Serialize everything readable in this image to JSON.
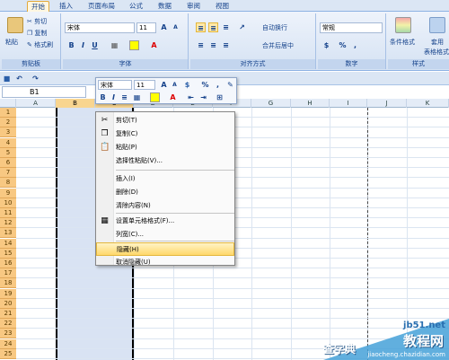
{
  "tabs": [
    "开始",
    "插入",
    "页面布局",
    "公式",
    "数据",
    "审阅",
    "视图"
  ],
  "clipboard": {
    "paste": "粘贴",
    "cut": "剪切",
    "copy": "复制",
    "format_painter": "格式刷",
    "label": "剪贴板"
  },
  "font": {
    "name": "宋体",
    "size": "11",
    "label": "字体",
    "bold": "B",
    "italic": "I",
    "underline": "U",
    "grow": "A",
    "shrink": "A"
  },
  "alignment": {
    "wrap": "自动换行",
    "merge": "合并后居中",
    "label": "对齐方式"
  },
  "number": {
    "format": "常规",
    "percent": "%",
    "comma": ",",
    "label": "数字"
  },
  "styles": {
    "conditional": "条件格式",
    "table": "套用",
    "table2": "表格格式",
    "label": "样式"
  },
  "name_box": "B1",
  "columns": [
    "A",
    "B",
    "C",
    "D",
    "E",
    "F",
    "G",
    "H",
    "I",
    "J",
    "K"
  ],
  "rows": [
    "1",
    "2",
    "3",
    "4",
    "5",
    "6",
    "7",
    "8",
    "9",
    "10",
    "11",
    "12",
    "13",
    "14",
    "15",
    "16",
    "17",
    "18",
    "19",
    "20",
    "21",
    "22",
    "23",
    "24",
    "25"
  ],
  "mini_toolbar": {
    "font": "宋体",
    "size": "11",
    "bold": "B",
    "italic": "I",
    "percent": "%",
    "comma": ","
  },
  "context_menu": [
    {
      "label": "剪切(T)",
      "icon": "scissors-icon",
      "glyph": "✂"
    },
    {
      "label": "复制(C)",
      "icon": "copy-icon",
      "glyph": "❐"
    },
    {
      "label": "粘贴(P)",
      "icon": "paste-icon",
      "glyph": "📋"
    },
    {
      "label": "选择性粘贴(V)...",
      "icon": "",
      "glyph": ""
    },
    {
      "label": "插入(I)",
      "icon": "",
      "glyph": ""
    },
    {
      "label": "删除(D)",
      "icon": "",
      "glyph": ""
    },
    {
      "label": "清除内容(N)",
      "icon": "",
      "glyph": ""
    },
    {
      "label": "设置单元格格式(F)...",
      "icon": "format-cells-icon",
      "glyph": "▦"
    },
    {
      "label": "列宽(C)...",
      "icon": "",
      "glyph": ""
    },
    {
      "label": "隐藏(H)",
      "icon": "",
      "glyph": ""
    },
    {
      "label": "取消隐藏(U)",
      "icon": "",
      "glyph": ""
    }
  ],
  "watermark": {
    "site": "jb51.net",
    "title": "教程网",
    "url": "jiaocheng.chazidian.com",
    "left": "查字典"
  }
}
